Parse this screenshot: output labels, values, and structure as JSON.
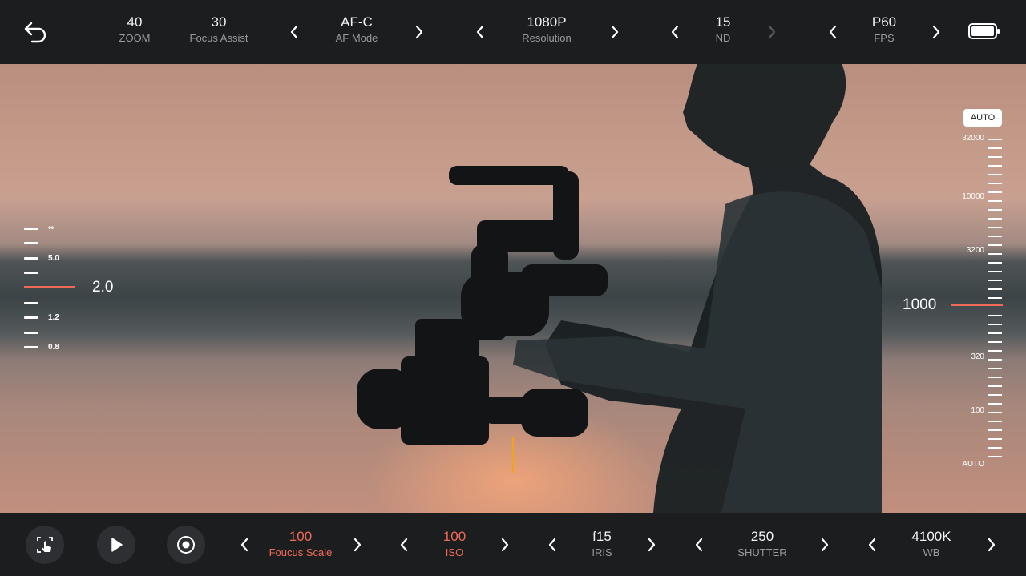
{
  "top_bar": {
    "zoom": {
      "value": "40",
      "label": "ZOOM"
    },
    "focus_assist": {
      "value": "30",
      "label": "Focus Assist"
    },
    "af_mode": {
      "value": "AF-C",
      "label": "AF Mode"
    },
    "resolution": {
      "value": "1080P",
      "label": "Resolution"
    },
    "nd": {
      "value": "15",
      "label": "ND"
    },
    "fps": {
      "value": "P60",
      "label": "FPS"
    }
  },
  "focus_scale": {
    "labels": [
      "∞",
      "5.0",
      "1.2",
      "0.8"
    ],
    "current": "2.0"
  },
  "iso_scale": {
    "auto_label": "AUTO",
    "labels": [
      "32000",
      "10000",
      "3200",
      "320",
      "100",
      "AUTO"
    ],
    "current": "1000"
  },
  "bottom_bar": {
    "focus_scale": {
      "value": "100",
      "label": "Foucus Scale"
    },
    "iso": {
      "value": "100",
      "label": "ISO"
    },
    "iris": {
      "value": "f15",
      "label": "IRIS"
    },
    "shutter": {
      "value": "250",
      "label": "SHUTTER"
    },
    "wb": {
      "value": "4100K",
      "label": "WB"
    }
  },
  "colors": {
    "accent": "#ef6a57",
    "focus_marker": "#f0a320",
    "bar_bg": "#1c1d1f"
  },
  "icons": [
    "back-arrow-icon",
    "chevron-left-icon",
    "chevron-right-icon",
    "battery-icon",
    "touch-focus-icon",
    "play-icon",
    "record-icon"
  ]
}
